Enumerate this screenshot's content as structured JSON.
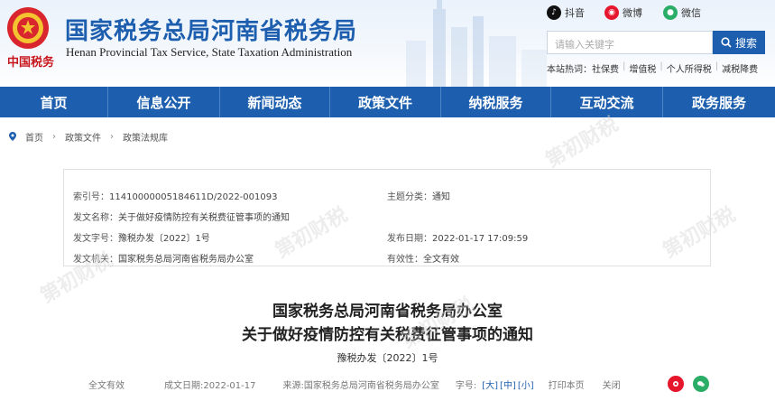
{
  "header": {
    "title": "国家税务总局河南省税务局",
    "subtitle": "Henan Provincial Tax Service, State Taxation Administration",
    "brand_text": "中国税务",
    "social": [
      {
        "label": "抖音",
        "icon": "douyin-icon",
        "color": "#111111"
      },
      {
        "label": "微博",
        "icon": "weibo-icon",
        "color": "#e6162d"
      },
      {
        "label": "微信",
        "icon": "wechat-icon",
        "color": "#2aae67"
      }
    ],
    "search": {
      "placeholder": "请输入关键字",
      "button_label": "搜索"
    },
    "quicklinks_prefix": "本站热词：",
    "quicklinks": [
      "社保费",
      "增值税",
      "个人所得税",
      "减税降费"
    ]
  },
  "nav": [
    "首页",
    "信息公开",
    "新闻动态",
    "政策文件",
    "纳税服务",
    "互动交流",
    "政务服务"
  ],
  "breadcrumb": [
    "首页",
    "政策文件",
    "政策法规库"
  ],
  "meta": {
    "index_label": "索引号：",
    "index_value": "11410000005184611D/2022-001093",
    "category_label": "主题分类：",
    "category_value": "通知",
    "docname_label": "发文名称：",
    "docname_value": "关于做好疫情防控有关税费征管事项的通知",
    "docno_label": "发文字号：",
    "docno_value": "豫税办发〔2022〕1号",
    "pubdate_label": "发布日期：",
    "pubdate_value": "2022-01-17 17:09:59",
    "agency_label": "发文机关：",
    "agency_value": "国家税务总局河南省税务局办公室",
    "validity_label": "有效性：",
    "validity_value": "全文有效"
  },
  "article": {
    "title_line1": "国家税务总局河南省税务局办公室",
    "title_line2": "关于做好疫情防控有关税费征管事项的通知",
    "doc_number": "豫税办发〔2022〕1号"
  },
  "footer": {
    "validity": "全文有效",
    "date_label": "成文日期:2022-01-17",
    "source": "来源:国家税务总局河南省税务局办公室",
    "font_size_label": "字号:",
    "sizes": [
      "[大]",
      "[中]",
      "[小]"
    ],
    "print": "打印本页",
    "close": "关闭"
  },
  "watermark_text": "第初财税",
  "colors": {
    "brand_blue": "#1d5fae",
    "brand_red": "#c8161d"
  }
}
